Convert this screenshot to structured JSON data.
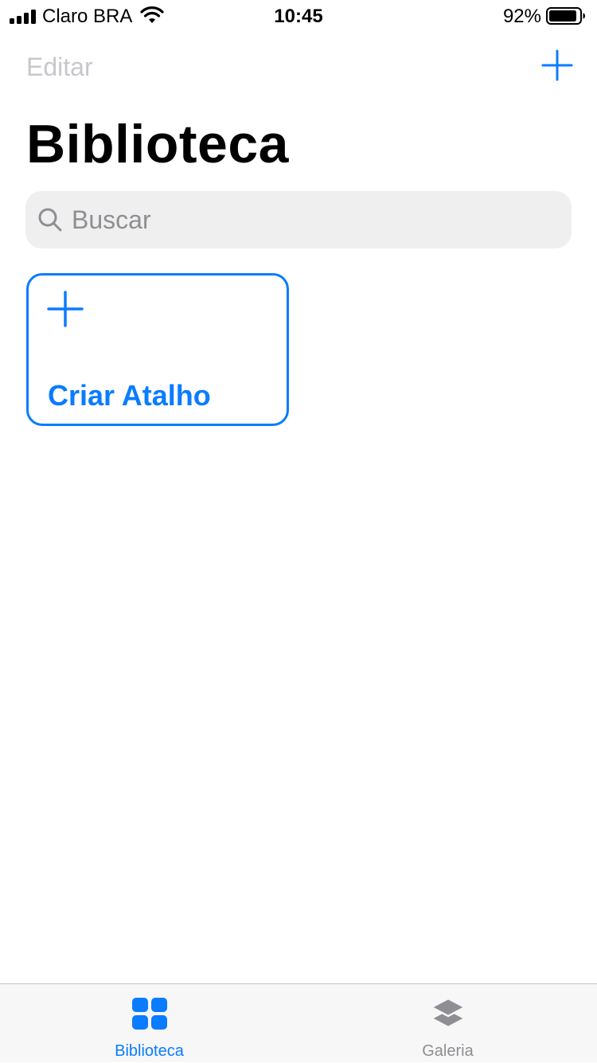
{
  "status_bar": {
    "carrier": "Claro BRA",
    "time": "10:45",
    "battery_percent": "92%",
    "battery_level": 0.92,
    "signal_bars": 4
  },
  "nav": {
    "edit_label": "Editar",
    "add_icon": "plus-icon"
  },
  "page": {
    "title": "Biblioteca"
  },
  "search": {
    "placeholder": "Buscar",
    "value": "",
    "icon": "search-icon"
  },
  "create_card": {
    "label": "Criar Atalho",
    "icon": "plus-icon"
  },
  "tab_bar": {
    "tabs": [
      {
        "label": "Biblioteca",
        "icon": "grid-icon",
        "selected": true
      },
      {
        "label": "Galeria",
        "icon": "layers-icon",
        "selected": false
      }
    ]
  },
  "colors": {
    "accent": "#0a7cff",
    "inactive": "#8e8e93",
    "disabled": "#c7c7cc",
    "search_bg": "#efeff0",
    "tab_bar_bg": "#f7f7f7"
  }
}
